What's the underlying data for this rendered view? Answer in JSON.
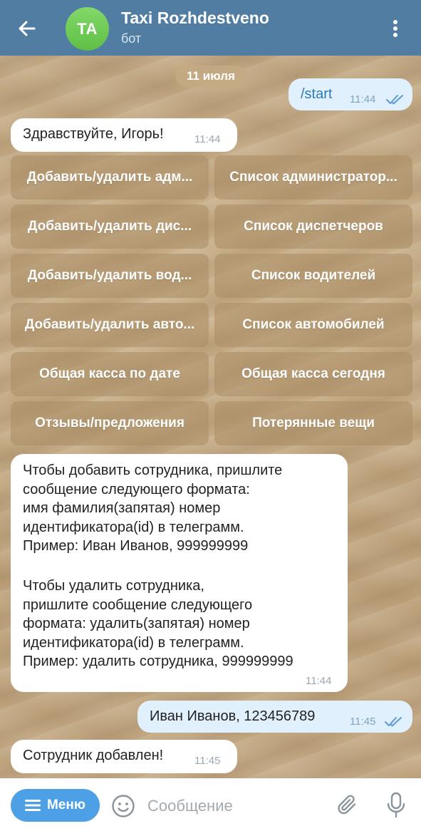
{
  "header": {
    "avatar_initials": "TA",
    "title": "Taxi Rozhdestveno",
    "subtitle": "бот",
    "accent": "#517da2"
  },
  "date_chip": "11 июля",
  "messages": {
    "start": {
      "text": "/start",
      "time": "11:44",
      "status": "read"
    },
    "greeting": {
      "text": "Здравствуйте, Игорь!",
      "time": "11:44"
    },
    "instructions": {
      "add_text": "Чтобы добавить сотрудника, пришлите\nсообщение следующего формата:\nимя фамилия(запятая) номер\nидентификатора(id) в телеграмм.\nПример: Иван Иванов, 999999999",
      "remove_text": "Чтобы удалить сотрудника,\nпришлите сообщение следующего\nформата: удалить(запятая) номер\nидентификатора(id) в телеграмм.\nПример: удалить сотрудника, 999999999",
      "time": "11:44"
    },
    "reply": {
      "text": "Иван Иванов, 123456789",
      "time": "11:45",
      "status": "read"
    },
    "added": {
      "text": "Сотрудник добавлен!",
      "time": "11:45"
    }
  },
  "keyboard": [
    [
      "Добавить/удалить администратора",
      "Список администраторов"
    ],
    [
      "Добавить/удалить диспетчера",
      "Список диспетчеров"
    ],
    [
      "Добавить/удалить водителя",
      "Список водителей"
    ],
    [
      "Добавить/удалить автомобиль",
      "Список автомобилей"
    ],
    [
      "Общая касса по дате",
      "Общая касса сегодня"
    ],
    [
      "Отзывы/предложения",
      "Потерянные вещи"
    ]
  ],
  "keyboard_display": [
    [
      "Добавить/удалить адм...",
      "Список администратор..."
    ],
    [
      "Добавить/удалить дис...",
      "Список диспетчеров"
    ],
    [
      "Добавить/удалить вод...",
      "Список водителей"
    ],
    [
      "Добавить/удалить авто...",
      "Список автомобилей"
    ],
    [
      "Общая касса по дате",
      "Общая касса сегодня"
    ],
    [
      "Отзывы/предложения",
      "Потерянные вещи"
    ]
  ],
  "input_bar": {
    "menu_label": "Меню",
    "placeholder": "Сообщение"
  }
}
